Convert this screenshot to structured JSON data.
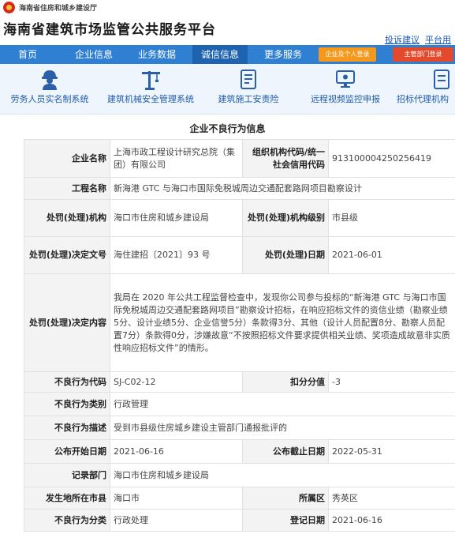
{
  "header": {
    "dept": "海南省住房和城乡建设厅",
    "title": "海南省建筑市场监管公共服务平台",
    "links": [
      "投诉建议",
      "平台用"
    ]
  },
  "nav": {
    "items": [
      "首页",
      "企业信息",
      "业务数据",
      "诚信信息",
      "更多服务"
    ],
    "active_index": 3,
    "enterprise_login": "企业及个人登录",
    "dept_login": "主管部门登录"
  },
  "systems": [
    {
      "label": "劳务人员实名制系统",
      "icon": "worker-helmet-icon"
    },
    {
      "label": "建筑机械安全管理系统",
      "icon": "tower-crane-icon"
    },
    {
      "label": "建筑施工安责险",
      "icon": "insurance-document-icon"
    },
    {
      "label": "远程视频监控申报",
      "icon": "video-monitor-icon"
    },
    {
      "label": "招标代理机构",
      "icon": "bidding-document-icon"
    }
  ],
  "section_title": "企业不良行为信息",
  "record": {
    "company_name_label": "企业名称",
    "company_name": "上海市政工程设计研究总院（集团）有限公司",
    "org_code_label": "组织机构代码/统一社会信用代码",
    "org_code": "913100004250256419",
    "project_label": "工程名称",
    "project": "新海港 GTC 与海口市国际免税城周边交通配套路网项目勘察设计",
    "authority_label": "处罚(处理)机构",
    "authority": "海口市住房和城乡建设局",
    "authority_level_label": "处罚(处理)机构级别",
    "authority_level": "市县级",
    "decision_no_label": "处罚(处理)决定文号",
    "decision_no": "海住建招〔2021〕93 号",
    "decision_date_label": "处罚(处理)日期",
    "decision_date": "2021-06-01",
    "decision_content_label": "处罚(处理)决定内容",
    "decision_content": "我局在 2020 年公共工程监督检查中，发现你公司参与投标的“新海港 GTC 与海口市国际免税城周边交通配套路网项目”勘察设计招标，在响应招标文件的资信业绩（勘察业绩5分、设计业绩5分、企业信誉5分）条款得3分、其他（设计人员配置8分、勘察人员配置7分）条款得0分，涉嫌故意“不按照招标文件要求提供相关业绩、奖项造成故意非实质性响应招标文件”的情形。",
    "behavior_code_label": "不良行为代码",
    "behavior_code": "SJ-C02-12",
    "deduction_label": "扣分分值",
    "deduction": "-3",
    "category_label": "不良行为类别",
    "category": "行政管理",
    "behavior_desc_label": "不良行为描述",
    "behavior_desc": "受到市县级住房城乡建设主管部门通报批评的",
    "publish_start_label": "公布开始日期",
    "publish_start": "2021-06-16",
    "publish_end_label": "公布截止日期",
    "publish_end": "2022-05-31",
    "record_dept_label": "记录部门",
    "record_dept": "海口市住房和城乡建设局",
    "city_label": "发生地所在市县",
    "city": "海口市",
    "district_label": "所属区",
    "district": "秀英区",
    "classification_label": "不良行为分类",
    "classification": "行政处理",
    "register_date_label": "登记日期",
    "register_date": "2021-06-16"
  }
}
